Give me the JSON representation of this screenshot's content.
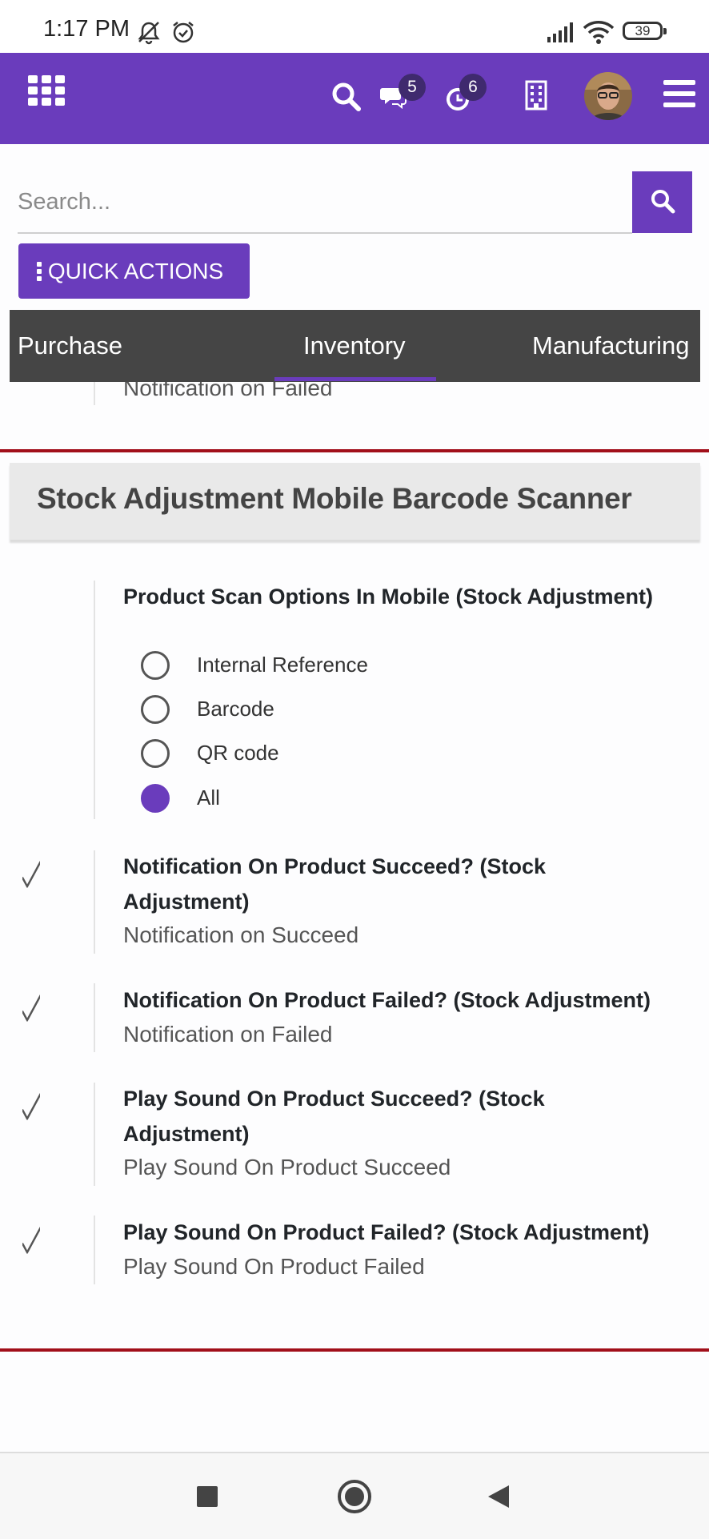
{
  "status_bar": {
    "time": "1:17 PM",
    "battery": "39"
  },
  "header": {
    "chat_badge": "5",
    "activity_badge": "6"
  },
  "search": {
    "placeholder": "Search..."
  },
  "quick_actions_label": "QUICK ACTIONS",
  "tabs": [
    {
      "label": "Purchase"
    },
    {
      "label": "Inventory",
      "active": true
    },
    {
      "label": "Manufacturing"
    }
  ],
  "previous_item_desc": "Notification on Failed",
  "section": {
    "title": "Stock Adjustment Mobile Barcode Scanner",
    "scan_options": {
      "title": "Product Scan Options In Mobile (Stock Adjustment)",
      "options": [
        "Internal Reference",
        "Barcode",
        "QR code",
        "All"
      ],
      "selected": "All"
    },
    "settings": [
      {
        "title_line1": "Notification On Product Succeed? (Stock",
        "title_line2": "Adjustment)",
        "desc": "Notification on Succeed",
        "checked": true
      },
      {
        "title_line1": "Notification On Product Failed? (Stock Adjustment)",
        "desc": "Notification on Failed",
        "checked": true
      },
      {
        "title_line1": "Play Sound On Product Succeed? (Stock",
        "title_line2": "Adjustment)",
        "desc": "Play Sound On Product Succeed",
        "checked": true
      },
      {
        "title_line1": "Play Sound On Product Failed? (Stock Adjustment)",
        "desc": "Play Sound On Product Failed",
        "checked": true
      }
    ]
  },
  "colors": {
    "primary": "#6a3cbc",
    "tabs_bg": "#454545",
    "divider_red": "#a10f1a"
  }
}
